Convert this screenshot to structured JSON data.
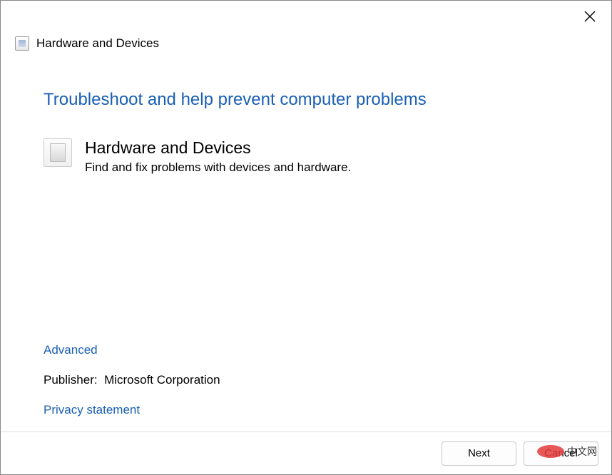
{
  "window": {
    "title": "Hardware and Devices"
  },
  "main": {
    "heading": "Troubleshoot and help prevent computer problems",
    "troubleshooter": {
      "title": "Hardware and Devices",
      "description": "Find and fix problems with devices and hardware."
    }
  },
  "links": {
    "advanced": "Advanced",
    "privacy": "Privacy statement"
  },
  "publisher": {
    "label": "Publisher:",
    "value": "Microsoft Corporation"
  },
  "buttons": {
    "next": "Next",
    "cancel": "Cancel"
  },
  "watermark": {
    "text": "中文网"
  }
}
